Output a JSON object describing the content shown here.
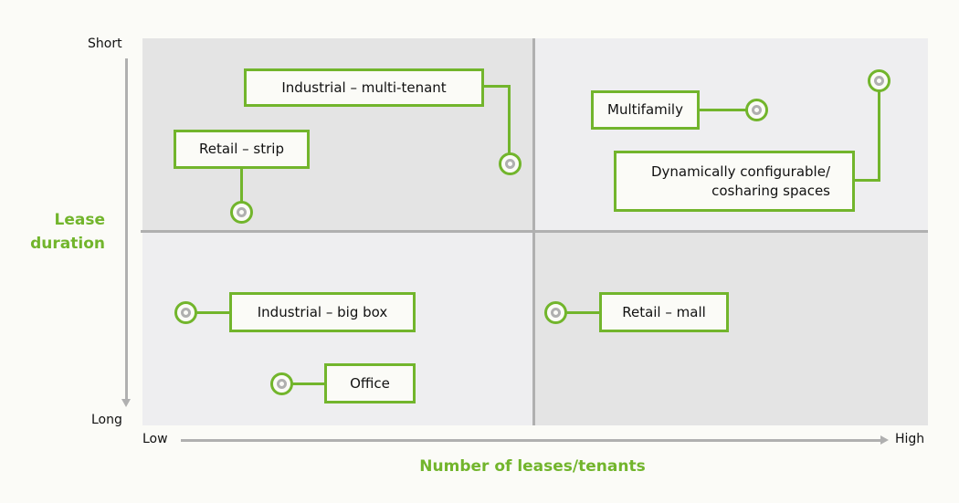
{
  "colors": {
    "accent": "#72b52c",
    "axis": "#b0b0b0",
    "quadrant_dark": "#e4e4e4",
    "quadrant_light": "#eeeef0",
    "background": "#fbfbf7"
  },
  "y_axis": {
    "title_line1": "Lease",
    "title_line2": "duration",
    "top_label": "Short",
    "bottom_label": "Long"
  },
  "x_axis": {
    "title": "Number of leases/tenants",
    "left_label": "Low",
    "right_label": "High"
  },
  "items": [
    {
      "id": "industrial-multi-tenant",
      "label": "Industrial – multi-tenant",
      "quadrant": "short-low",
      "marker_icon": "target-circle-icon"
    },
    {
      "id": "retail-strip",
      "label": "Retail – strip",
      "quadrant": "short-low",
      "marker_icon": "target-circle-icon"
    },
    {
      "id": "multifamily",
      "label": "Multifamily",
      "quadrant": "short-high",
      "marker_icon": "target-circle-icon"
    },
    {
      "id": "dynamically-configurable",
      "label_line1": "Dynamically configurable/",
      "label_line2": "cosharing spaces",
      "quadrant": "short-high",
      "marker_icon": "target-circle-icon"
    },
    {
      "id": "industrial-big-box",
      "label": "Industrial – big box",
      "quadrant": "long-low",
      "marker_icon": "target-circle-icon"
    },
    {
      "id": "office",
      "label": "Office",
      "quadrant": "long-low",
      "marker_icon": "target-circle-icon"
    },
    {
      "id": "retail-mall",
      "label": "Retail – mall",
      "quadrant": "long-high",
      "marker_icon": "target-circle-icon"
    }
  ]
}
